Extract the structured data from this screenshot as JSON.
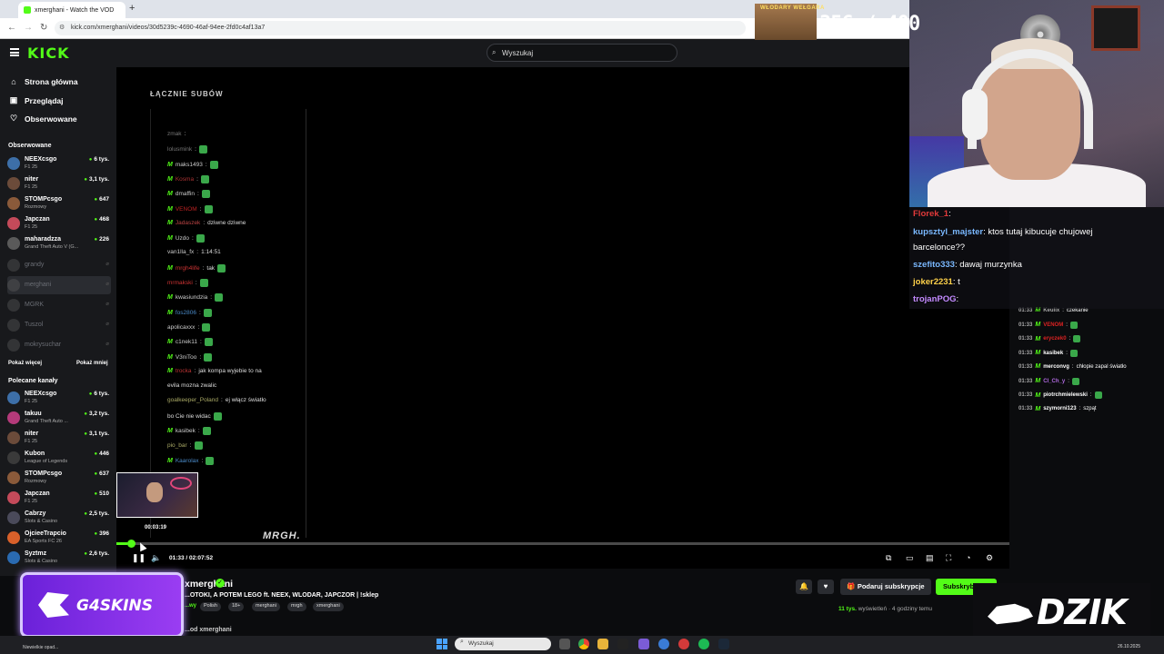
{
  "browser": {
    "tab_title": "xmerghani - Watch the VOD",
    "url": "kick.com/xmerghani/videos/30d5239c-4690-46af-94ee-2fd0c4af13a7"
  },
  "topnav": {
    "logo": "KICK",
    "search_placeholder": "Wyszukaj"
  },
  "sidebar": {
    "nav": [
      {
        "label": "Strona główna",
        "icon": "home-icon"
      },
      {
        "label": "Przeglądaj",
        "icon": "browse-icon"
      },
      {
        "label": "Obserwowane",
        "icon": "heart-icon"
      }
    ],
    "followed_title": "Obserwowane",
    "followed": [
      {
        "name": "NEEXcsgo",
        "game": "F1 25",
        "viewers": "6 tys.",
        "color": "#3d6fa8"
      },
      {
        "name": "niter",
        "game": "F1 25",
        "viewers": "3,1 tys.",
        "color": "#6b4b3a"
      },
      {
        "name": "STOMPcsgo",
        "game": "Rozmowy",
        "viewers": "647",
        "color": "#8a5a3a"
      },
      {
        "name": "Japczan",
        "game": "F1 25",
        "viewers": "468",
        "color": "#c44a5a"
      },
      {
        "name": "maharadzza",
        "game": "Grand Theft Auto V (G...",
        "viewers": "226",
        "color": "#5a5a5a"
      }
    ],
    "offline": [
      "grandy",
      "merghani",
      "MGRK",
      "Tuszol",
      "mokrysuchar"
    ],
    "show_more": "Pokaż więcej",
    "show_less": "Pokaż mniej",
    "recommended_title": "Polecane kanały",
    "recommended": [
      {
        "name": "NEEXcsgo",
        "game": "F1 25",
        "viewers": "6 tys.",
        "color": "#3d6fa8"
      },
      {
        "name": "takuu",
        "game": "Grand Theft Auto ...",
        "viewers": "3,2 tys.",
        "color": "#b43a7a"
      },
      {
        "name": "niter",
        "game": "F1 25",
        "viewers": "3,1 tys.",
        "color": "#6b4b3a"
      },
      {
        "name": "Kubon",
        "game": "League of Legends",
        "viewers": "446",
        "color": "#3a3a3a"
      },
      {
        "name": "STOMPcsgo",
        "game": "Rozmowy",
        "viewers": "637",
        "color": "#8a5a3a"
      },
      {
        "name": "Japczan",
        "game": "F1 25",
        "viewers": "510",
        "color": "#c44a5a"
      },
      {
        "name": "Cabrzy",
        "game": "Slots & Casino",
        "viewers": "2,5 tys.",
        "color": "#4a4a5a"
      },
      {
        "name": "OjcieeTrapcio",
        "game": "EA Sports FC 26",
        "viewers": "396",
        "color": "#d8602a"
      },
      {
        "name": "Syztmz",
        "game": "Slots & Casino",
        "viewers": "2,6 tys.",
        "color": "#2a6ab0"
      }
    ]
  },
  "video": {
    "overlay_title": "ŁĄCZNIE SUBÓW",
    "overlay_chat": [
      {
        "user": "zmak",
        "msg": "",
        "color": "#777",
        "badge": false,
        "emote": false
      },
      {
        "user": "lolusmink",
        "msg": "",
        "color": "#777",
        "badge": false,
        "emote": true
      },
      {
        "user": "maks1493",
        "msg": "",
        "color": "#ccc",
        "badge": true,
        "emote": true
      },
      {
        "user": "Kosma",
        "msg": "",
        "color": "#a33",
        "badge": true,
        "emote": true
      },
      {
        "user": "dmaffin",
        "msg": "",
        "color": "#ccc",
        "badge": true,
        "emote": true
      },
      {
        "user": "VENOM",
        "msg": "",
        "color": "#b22",
        "badge": true,
        "emote": true
      },
      {
        "user": "Jadaszek",
        "msg": "dziwne dziwne",
        "color": "#b44",
        "badge": true,
        "emote": false
      },
      {
        "user": "Uzdo",
        "msg": "",
        "color": "#ccc",
        "badge": true,
        "emote": true
      },
      {
        "user": "van1lla_fx",
        "msg": "1:14:51",
        "color": "#ccc",
        "badge": false,
        "emote": false
      },
      {
        "user": "mrgh4life",
        "msg": "tak",
        "color": "#c33",
        "badge": true,
        "emote": true
      },
      {
        "user": "mrmakski",
        "msg": "",
        "color": "#c33",
        "badge": false,
        "emote": true
      },
      {
        "user": "kwasiundzia",
        "msg": "",
        "color": "#ccc",
        "badge": true,
        "emote": true
      },
      {
        "user": "fos2806",
        "msg": "",
        "color": "#4a8ac8",
        "badge": true,
        "emote": true
      },
      {
        "user": "apolicaxxx",
        "msg": "",
        "color": "#ccc",
        "badge": false,
        "emote": true
      },
      {
        "user": "c1nek11",
        "msg": "",
        "color": "#ccc",
        "badge": true,
        "emote": true
      },
      {
        "user": "V3niToo",
        "msg": "",
        "color": "#ccc",
        "badge": true,
        "emote": true
      },
      {
        "user": "trocka",
        "msg": "jak kompa wyjebie to na",
        "color": "#b33",
        "badge": true,
        "emote": false
      },
      {
        "user": "",
        "msg": "evila mozna zwalic",
        "color": "#ccc",
        "badge": false,
        "emote": false
      },
      {
        "user": "goalkeeper_Poland",
        "msg": "ej włącz światło",
        "color": "#aa6",
        "badge": false,
        "emote": false
      },
      {
        "user": "",
        "msg": "bo Cie nie widac",
        "color": "#ccc",
        "badge": false,
        "emote": true
      },
      {
        "user": "kasibek",
        "msg": "",
        "color": "#ccc",
        "badge": true,
        "emote": true
      },
      {
        "user": "pio_bar",
        "msg": "",
        "color": "#aa6",
        "badge": false,
        "emote": true
      },
      {
        "user": "Kaarolax",
        "msg": "",
        "color": "#4a8ac8",
        "badge": true,
        "emote": true
      }
    ],
    "watermark": "MRGH.",
    "thumb_time": "00:03:19",
    "timecode": "01:33 / 02:07:52",
    "progress": 0.012
  },
  "stream": {
    "name": "xmerghani",
    "title": "...OTOKI, A POTEM LEGO ft. NEEX, WLODAR, JAPCZOR | !sklep",
    "tags": [
      "Polish",
      "18+",
      "merghani",
      "mrgh",
      "xmerghani"
    ],
    "category_fragment": "...wy",
    "gift_btn": "Podaruj subskrypcje",
    "sub_btn": "Subskrybuj",
    "views": "11 tys.",
    "views_label": "wyświetleń",
    "ago": "4 godziny temu",
    "below_fragment": "...od xmerghani"
  },
  "right_chat": [
    {
      "time": "01:33",
      "user": "Keulix",
      "msg": "czekanie",
      "color": "#aaa"
    },
    {
      "time": "01:33",
      "user": "VENOM",
      "msg": "",
      "color": "#d22"
    },
    {
      "time": "01:33",
      "user": "eryczek0",
      "msg": "",
      "color": "#d22"
    },
    {
      "time": "01:33",
      "user": "kasibek",
      "msg": "",
      "color": "#fff"
    },
    {
      "time": "01:33",
      "user": "merconvg",
      "msg": "chłopie zapal światło",
      "color": "#fff"
    },
    {
      "time": "01:33",
      "user": "CI_Ch_y",
      "msg": "",
      "color": "#b06ae0"
    },
    {
      "time": "01:33",
      "user": "piotrchmielewski",
      "msg": "",
      "color": "#fff"
    },
    {
      "time": "01:33",
      "user": "szymorni123",
      "msg": "szpąt",
      "color": "#fff"
    }
  ],
  "overlay": {
    "sub_goal": "356 / 400",
    "sub_goal_img": "WŁODARY WEŁGARA",
    "chat": [
      {
        "user": "Florek_1",
        "msg": "",
        "color": "#e23a3a"
      },
      {
        "user": "kupsztyl_majster",
        "msg": "ktos tutaj kibucuje chujowej",
        "color": "#7ab8ff"
      },
      {
        "user": "",
        "msg": "barcelonce??",
        "color": "#fff"
      },
      {
        "user": "szefito333",
        "msg": "dawaj murzynka",
        "color": "#7ab8ff"
      },
      {
        "user": "joker2231",
        "msg": "t",
        "color": "#ffd24a"
      },
      {
        "user": "trojanPOG",
        "msg": "",
        "color": "#c38aff"
      }
    ],
    "sponsor_left": "G4SKINS",
    "sponsor_right": "DZIK"
  },
  "taskbar": {
    "search": "Wyszukaj",
    "date": "26.10.2025",
    "weather": "Niewielkie opad..."
  },
  "colors": {
    "accent": "#53fc18",
    "bg": "#0b0c0e",
    "panel": "#18191c"
  }
}
